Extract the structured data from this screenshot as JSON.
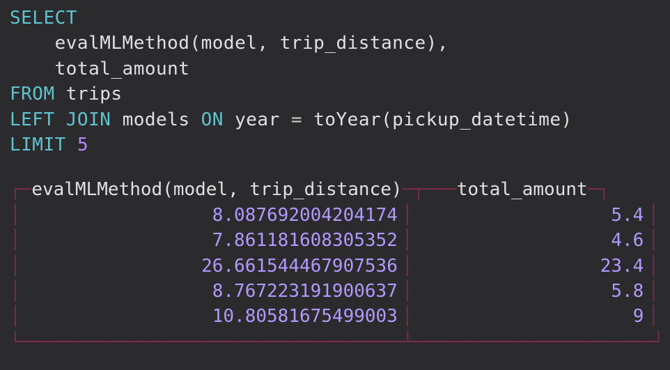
{
  "query": {
    "kw_select": "SELECT",
    "indent": "    ",
    "func_call": "evalMLMethod(model, trip_distance),",
    "col2": "total_amount",
    "kw_from": "FROM",
    "tbl": "trips",
    "kw_left": "LEFT",
    "kw_join": "JOIN",
    "tbl2": "models",
    "kw_on": "ON",
    "expr_on_left": "year",
    "eq": "=",
    "expr_on_right": "toYear(pickup_datetime)",
    "kw_limit": "LIMIT",
    "limit_n": "5"
  },
  "result": {
    "columns": [
      "evalMLMethod(model, trip_distance)",
      "total_amount"
    ],
    "rows": [
      [
        "8.087692004204174",
        "5.4"
      ],
      [
        "7.861181608305352",
        "4.6"
      ],
      [
        "26.661544467907536",
        "23.4"
      ],
      [
        "8.767223191900637",
        "5.8"
      ],
      [
        "10.80581675499003",
        "9"
      ]
    ]
  }
}
